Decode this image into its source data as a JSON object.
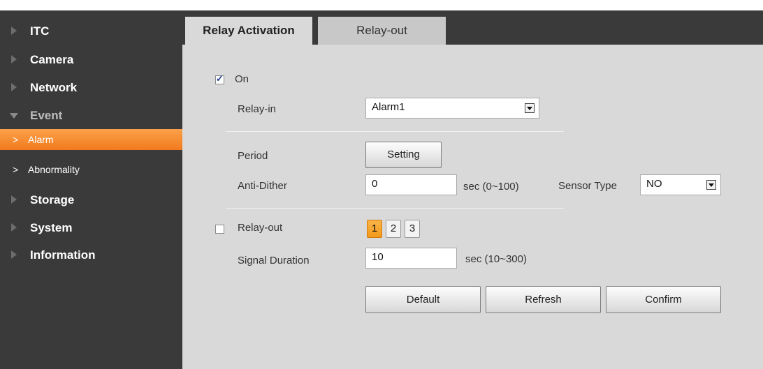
{
  "sidebar": {
    "items": [
      {
        "label": "ITC"
      },
      {
        "label": "Camera"
      },
      {
        "label": "Network"
      },
      {
        "label": "Event"
      },
      {
        "label": "Alarm"
      },
      {
        "label": "Abnormality"
      },
      {
        "label": "Storage"
      },
      {
        "label": "System"
      },
      {
        "label": "Information"
      }
    ]
  },
  "tabs": [
    {
      "label": "Relay Activation",
      "active": true
    },
    {
      "label": "Relay-out",
      "active": false
    }
  ],
  "form": {
    "on": {
      "label": "On",
      "checked": true
    },
    "relay_in": {
      "label": "Relay-in",
      "value": "Alarm1"
    },
    "period": {
      "label": "Period",
      "button": "Setting"
    },
    "anti_dither": {
      "label": "Anti-Dither",
      "value": "0",
      "unit": "sec (0~100)"
    },
    "sensor_type": {
      "label": "Sensor Type",
      "value": "NO"
    },
    "relay_out": {
      "label": "Relay-out",
      "checked": false,
      "channels": [
        "1",
        "2",
        "3"
      ],
      "selected": "1"
    },
    "signal_duration": {
      "label": "Signal Duration",
      "value": "10",
      "unit": "sec (10~300)"
    }
  },
  "buttons": {
    "default": "Default",
    "refresh": "Refresh",
    "confirm": "Confirm"
  },
  "colors": {
    "sidebar_bg": "#3a3a3a",
    "content_bg": "#d9d9d9",
    "accent": "#f28a2a"
  }
}
